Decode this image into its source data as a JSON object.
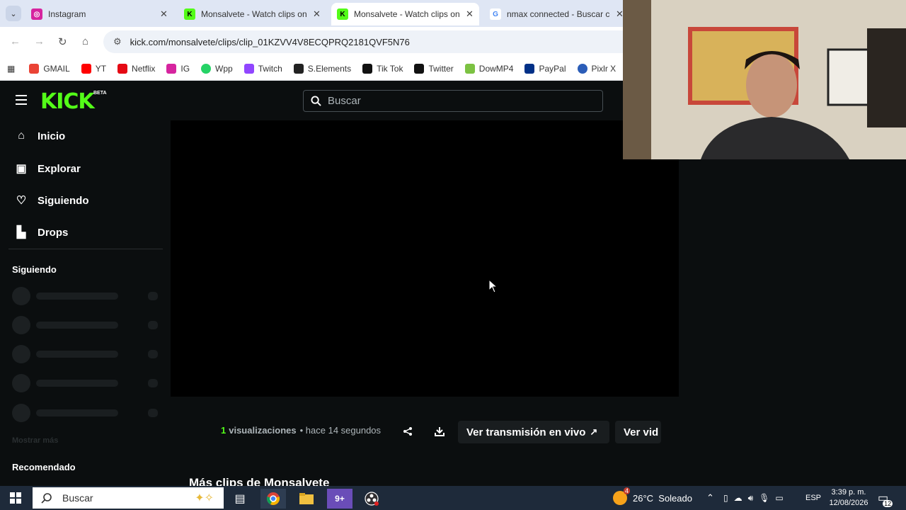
{
  "browser": {
    "tabs": [
      {
        "title": "Instagram",
        "active": false
      },
      {
        "title": "Monsalvete - Watch clips on K",
        "active": false
      },
      {
        "title": "Monsalvete - Watch clips on K",
        "active": true
      },
      {
        "title": "nmax connected - Buscar con",
        "active": false
      }
    ],
    "url": "kick.com/monsalvete/clips/clip_01KZVV4V8ECQPRQ2181QVF5N76",
    "bookmarks": [
      {
        "label": "GMAIL",
        "color": "#ea4335"
      },
      {
        "label": "YT",
        "color": "#ff0000"
      },
      {
        "label": "Netflix",
        "color": "#e50914"
      },
      {
        "label": "IG",
        "color": "#d6249f"
      },
      {
        "label": "Wpp",
        "color": "#25d366"
      },
      {
        "label": "Twitch",
        "color": "#9146ff"
      },
      {
        "label": "S.Elements",
        "color": "#222222"
      },
      {
        "label": "Tik Tok",
        "color": "#111111"
      },
      {
        "label": "Twitter",
        "color": "#111111"
      },
      {
        "label": "DowMP4",
        "color": "#7cc242"
      },
      {
        "label": "PayPal",
        "color": "#003087"
      },
      {
        "label": "Pixlr X",
        "color": "#2b5db8"
      }
    ]
  },
  "kick": {
    "logo": "KICK",
    "beta": "BETA",
    "search_placeholder": "Buscar",
    "nav": [
      {
        "label": "Inicio",
        "icon": "home-icon"
      },
      {
        "label": "Explorar",
        "icon": "explore-icon"
      },
      {
        "label": "Siguiendo",
        "icon": "heart-icon"
      },
      {
        "label": "Drops",
        "icon": "drops-icon"
      }
    ],
    "following_heading": "Siguiendo",
    "show_more": "Mostrar más",
    "recommended_heading": "Recomendado",
    "clip": {
      "views_count": "1",
      "views_label": "visualizaciones",
      "time": "• hace 14 segundos",
      "live_button": "Ver transmisión en vivo",
      "vod_button": "Ver vid"
    },
    "more_clips": "Más clips de Monsalvete"
  },
  "taskbar": {
    "search": "Buscar",
    "weather": "26°C  Soleado",
    "weather_badge": "4",
    "lang": "ESP",
    "time": "3:39 p. m.",
    "date": "12/08/2026",
    "notif_count": "12"
  },
  "colors": {
    "kick_green": "#53fc18",
    "page_bg": "#0b0e0f"
  }
}
